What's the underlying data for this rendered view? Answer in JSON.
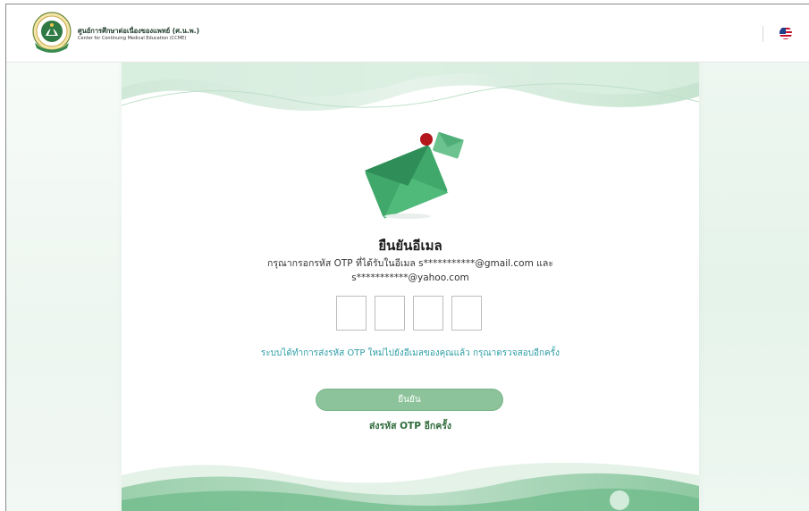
{
  "header": {
    "brand_th": "ศูนย์การศึกษาต่อเนื่องของแพทย์ (ศ.น.พ.)",
    "brand_en": "Center for Continuing Medical Education (CCME)",
    "language_icon": "us-flag-icon"
  },
  "verify": {
    "title": "ยืนยันอีเมล",
    "description": "กรุณากรอกรหัส OTP ที่ได้รับในอีเมล s***********@gmail.com และ s***********@yahoo.com",
    "otp_values": [
      "",
      "",
      "",
      ""
    ],
    "info": "ระบบได้ทำการส่งรหัส OTP ใหม่ไปยังอีเมลของคุณแล้ว กรุณาตรวจสอบอีกครั้ง",
    "confirm_label": "ยืนยัน",
    "resend_label": "ส่งรหัส OTP อีกครั้ง"
  },
  "colors": {
    "accent_green": "#8cc39a",
    "info_teal": "#2f9ea6",
    "resend_green": "#2f6b3b",
    "envelope_green": "#3fa86a",
    "notification_red": "#b3161b"
  }
}
